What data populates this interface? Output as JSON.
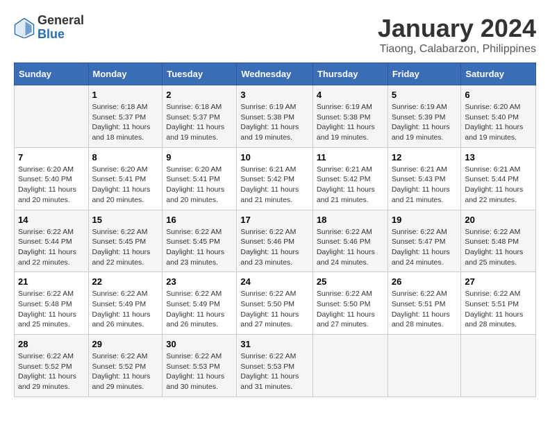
{
  "logo": {
    "text_general": "General",
    "text_blue": "Blue"
  },
  "header": {
    "month": "January 2024",
    "location": "Tiaong, Calabarzon, Philippines"
  },
  "weekdays": [
    "Sunday",
    "Monday",
    "Tuesday",
    "Wednesday",
    "Thursday",
    "Friday",
    "Saturday"
  ],
  "weeks": [
    [
      {
        "day": "",
        "sunrise": "",
        "sunset": "",
        "daylight": ""
      },
      {
        "day": "1",
        "sunrise": "Sunrise: 6:18 AM",
        "sunset": "Sunset: 5:37 PM",
        "daylight": "Daylight: 11 hours and 18 minutes."
      },
      {
        "day": "2",
        "sunrise": "Sunrise: 6:18 AM",
        "sunset": "Sunset: 5:37 PM",
        "daylight": "Daylight: 11 hours and 19 minutes."
      },
      {
        "day": "3",
        "sunrise": "Sunrise: 6:19 AM",
        "sunset": "Sunset: 5:38 PM",
        "daylight": "Daylight: 11 hours and 19 minutes."
      },
      {
        "day": "4",
        "sunrise": "Sunrise: 6:19 AM",
        "sunset": "Sunset: 5:38 PM",
        "daylight": "Daylight: 11 hours and 19 minutes."
      },
      {
        "day": "5",
        "sunrise": "Sunrise: 6:19 AM",
        "sunset": "Sunset: 5:39 PM",
        "daylight": "Daylight: 11 hours and 19 minutes."
      },
      {
        "day": "6",
        "sunrise": "Sunrise: 6:20 AM",
        "sunset": "Sunset: 5:40 PM",
        "daylight": "Daylight: 11 hours and 19 minutes."
      }
    ],
    [
      {
        "day": "7",
        "sunrise": "Sunrise: 6:20 AM",
        "sunset": "Sunset: 5:40 PM",
        "daylight": "Daylight: 11 hours and 20 minutes."
      },
      {
        "day": "8",
        "sunrise": "Sunrise: 6:20 AM",
        "sunset": "Sunset: 5:41 PM",
        "daylight": "Daylight: 11 hours and 20 minutes."
      },
      {
        "day": "9",
        "sunrise": "Sunrise: 6:20 AM",
        "sunset": "Sunset: 5:41 PM",
        "daylight": "Daylight: 11 hours and 20 minutes."
      },
      {
        "day": "10",
        "sunrise": "Sunrise: 6:21 AM",
        "sunset": "Sunset: 5:42 PM",
        "daylight": "Daylight: 11 hours and 21 minutes."
      },
      {
        "day": "11",
        "sunrise": "Sunrise: 6:21 AM",
        "sunset": "Sunset: 5:42 PM",
        "daylight": "Daylight: 11 hours and 21 minutes."
      },
      {
        "day": "12",
        "sunrise": "Sunrise: 6:21 AM",
        "sunset": "Sunset: 5:43 PM",
        "daylight": "Daylight: 11 hours and 21 minutes."
      },
      {
        "day": "13",
        "sunrise": "Sunrise: 6:21 AM",
        "sunset": "Sunset: 5:44 PM",
        "daylight": "Daylight: 11 hours and 22 minutes."
      }
    ],
    [
      {
        "day": "14",
        "sunrise": "Sunrise: 6:22 AM",
        "sunset": "Sunset: 5:44 PM",
        "daylight": "Daylight: 11 hours and 22 minutes."
      },
      {
        "day": "15",
        "sunrise": "Sunrise: 6:22 AM",
        "sunset": "Sunset: 5:45 PM",
        "daylight": "Daylight: 11 hours and 22 minutes."
      },
      {
        "day": "16",
        "sunrise": "Sunrise: 6:22 AM",
        "sunset": "Sunset: 5:45 PM",
        "daylight": "Daylight: 11 hours and 23 minutes."
      },
      {
        "day": "17",
        "sunrise": "Sunrise: 6:22 AM",
        "sunset": "Sunset: 5:46 PM",
        "daylight": "Daylight: 11 hours and 23 minutes."
      },
      {
        "day": "18",
        "sunrise": "Sunrise: 6:22 AM",
        "sunset": "Sunset: 5:46 PM",
        "daylight": "Daylight: 11 hours and 24 minutes."
      },
      {
        "day": "19",
        "sunrise": "Sunrise: 6:22 AM",
        "sunset": "Sunset: 5:47 PM",
        "daylight": "Daylight: 11 hours and 24 minutes."
      },
      {
        "day": "20",
        "sunrise": "Sunrise: 6:22 AM",
        "sunset": "Sunset: 5:48 PM",
        "daylight": "Daylight: 11 hours and 25 minutes."
      }
    ],
    [
      {
        "day": "21",
        "sunrise": "Sunrise: 6:22 AM",
        "sunset": "Sunset: 5:48 PM",
        "daylight": "Daylight: 11 hours and 25 minutes."
      },
      {
        "day": "22",
        "sunrise": "Sunrise: 6:22 AM",
        "sunset": "Sunset: 5:49 PM",
        "daylight": "Daylight: 11 hours and 26 minutes."
      },
      {
        "day": "23",
        "sunrise": "Sunrise: 6:22 AM",
        "sunset": "Sunset: 5:49 PM",
        "daylight": "Daylight: 11 hours and 26 minutes."
      },
      {
        "day": "24",
        "sunrise": "Sunrise: 6:22 AM",
        "sunset": "Sunset: 5:50 PM",
        "daylight": "Daylight: 11 hours and 27 minutes."
      },
      {
        "day": "25",
        "sunrise": "Sunrise: 6:22 AM",
        "sunset": "Sunset: 5:50 PM",
        "daylight": "Daylight: 11 hours and 27 minutes."
      },
      {
        "day": "26",
        "sunrise": "Sunrise: 6:22 AM",
        "sunset": "Sunset: 5:51 PM",
        "daylight": "Daylight: 11 hours and 28 minutes."
      },
      {
        "day": "27",
        "sunrise": "Sunrise: 6:22 AM",
        "sunset": "Sunset: 5:51 PM",
        "daylight": "Daylight: 11 hours and 28 minutes."
      }
    ],
    [
      {
        "day": "28",
        "sunrise": "Sunrise: 6:22 AM",
        "sunset": "Sunset: 5:52 PM",
        "daylight": "Daylight: 11 hours and 29 minutes."
      },
      {
        "day": "29",
        "sunrise": "Sunrise: 6:22 AM",
        "sunset": "Sunset: 5:52 PM",
        "daylight": "Daylight: 11 hours and 29 minutes."
      },
      {
        "day": "30",
        "sunrise": "Sunrise: 6:22 AM",
        "sunset": "Sunset: 5:53 PM",
        "daylight": "Daylight: 11 hours and 30 minutes."
      },
      {
        "day": "31",
        "sunrise": "Sunrise: 6:22 AM",
        "sunset": "Sunset: 5:53 PM",
        "daylight": "Daylight: 11 hours and 31 minutes."
      },
      {
        "day": "",
        "sunrise": "",
        "sunset": "",
        "daylight": ""
      },
      {
        "day": "",
        "sunrise": "",
        "sunset": "",
        "daylight": ""
      },
      {
        "day": "",
        "sunrise": "",
        "sunset": "",
        "daylight": ""
      }
    ]
  ]
}
